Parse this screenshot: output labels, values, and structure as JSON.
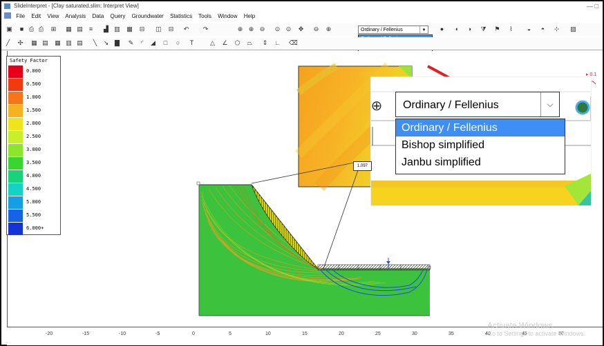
{
  "window": {
    "title": "SlideInterpret - [Clay saturated.slim: Interpret View]",
    "controls": "— □"
  },
  "menu": [
    "File",
    "Edit",
    "View",
    "Analysis",
    "Data",
    "Query",
    "Groundwater",
    "Statistics",
    "Tools",
    "Window",
    "Help"
  ],
  "method_select": {
    "selected": "Ordinary / Fellenius",
    "options": [
      "Ordinary / Fellenius",
      "Bishop simplified",
      "Janbu simplified"
    ],
    "highlighted_index": 0
  },
  "legend": {
    "title": "Safety Factor",
    "items": [
      {
        "label": "0.000",
        "color": "#e8001a"
      },
      {
        "label": "0.500",
        "color": "#f23a10"
      },
      {
        "label": "1.000",
        "color": "#f7741a"
      },
      {
        "label": "1.500",
        "color": "#f7b21f"
      },
      {
        "label": "2.000",
        "color": "#eee51e"
      },
      {
        "label": "2.500",
        "color": "#c9ef2a"
      },
      {
        "label": "3.000",
        "color": "#8ee52e"
      },
      {
        "label": "3.500",
        "color": "#39d531"
      },
      {
        "label": "4.000",
        "color": "#18d37a"
      },
      {
        "label": "4.500",
        "color": "#16d2c4"
      },
      {
        "label": "5.000",
        "color": "#149ee8"
      },
      {
        "label": "5.500",
        "color": "#1663e8"
      },
      {
        "label": "6.000+",
        "color": "#1632d9"
      }
    ]
  },
  "min_fs_label": "1.097",
  "axis_ticks": [
    "-20",
    "-15",
    "-10",
    "-5",
    "0",
    "5",
    "10",
    "15",
    "20",
    "25",
    "30",
    "35",
    "40",
    "45",
    "50"
  ],
  "watermark": {
    "line1": "Activate Windows",
    "line2": "Go to Settings to activate Windows."
  },
  "colors": {
    "ground": "#3cc23c",
    "slip_surface": "#1b4fd6",
    "highlight": "#3399ff",
    "arrow": "#e02020"
  }
}
